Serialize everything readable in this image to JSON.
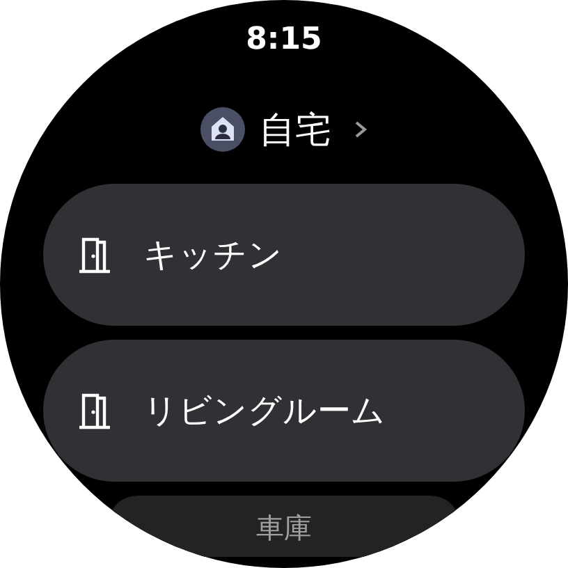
{
  "status_bar": {
    "time": "8:15"
  },
  "header": {
    "title": "自宅"
  },
  "rooms": [
    {
      "name": "キッチン"
    },
    {
      "name": "リビングルーム"
    },
    {
      "name": "車庫"
    }
  ]
}
